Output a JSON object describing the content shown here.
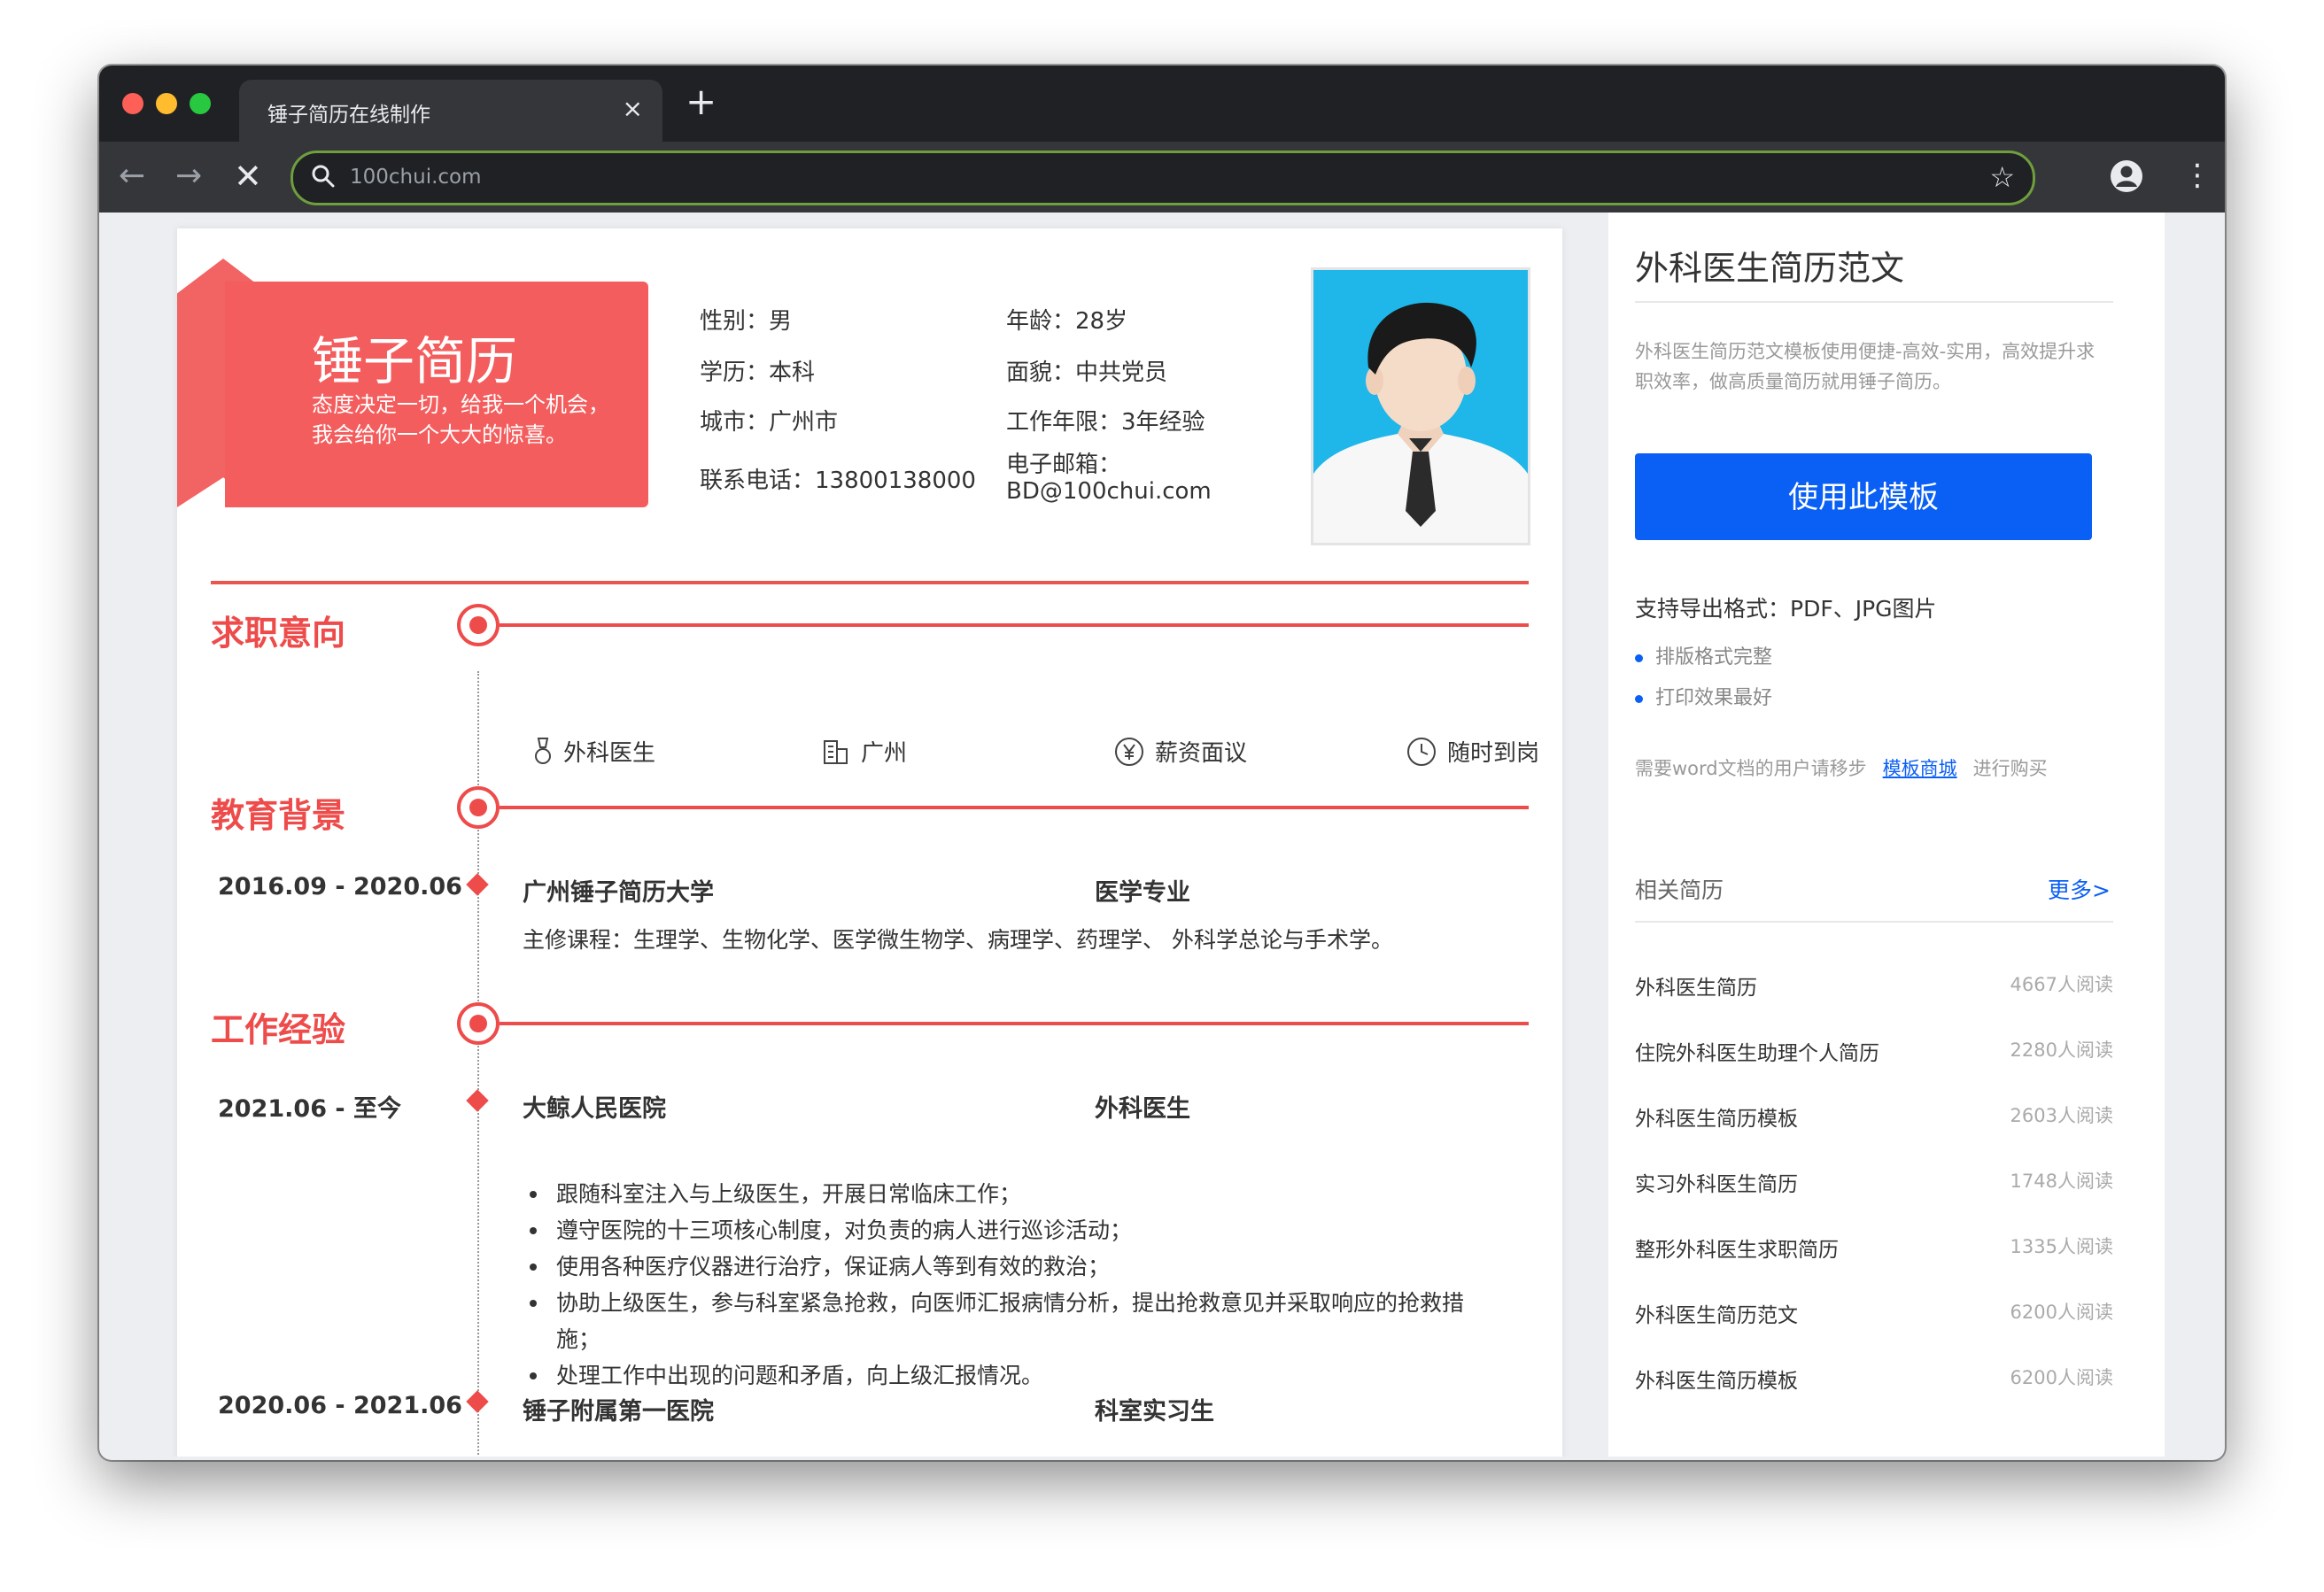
{
  "browser": {
    "tab_title": "锤子简历在线制作",
    "tab_close": "×",
    "new_tab": "+",
    "url": "100chui.com",
    "back": "←",
    "forward": "→",
    "stop": "✕",
    "bookmark_star": "☆",
    "menu": "⋮"
  },
  "resume": {
    "name": "锤子简历",
    "motto": "态度决定一切，给我一个机会，我会给你一个大大的惊喜。",
    "info": {
      "gender": "性别：男",
      "age": "年龄：28岁",
      "education": "学历：本科",
      "politics": "面貌：中共党员",
      "city": "城市：广州市",
      "experience_years": "工作年限：3年经验",
      "phone": "联系电话：13800138000",
      "email_label": "电子邮箱：",
      "email": "BD@100chui.com"
    },
    "sections": {
      "intent": "求职意向",
      "education": "教育背景",
      "work": "工作经验"
    },
    "intent_items": [
      {
        "icon": "medal-icon",
        "label": "外科医生"
      },
      {
        "icon": "building-icon",
        "label": "广州"
      },
      {
        "icon": "yen-icon",
        "label": "薪资面议"
      },
      {
        "icon": "clock-icon",
        "label": "随时到岗"
      }
    ],
    "education": {
      "date": "2016.09 - 2020.06",
      "school": "广州锤子简历大学",
      "major": "医学专业",
      "courses": "主修课程：生理学、生物化学、医学微生物学、病理学、药理学、 外科学总论与手术学。"
    },
    "work": [
      {
        "date": "2021.06 - 至今",
        "org": "大鲸人民医院",
        "role": "外科医生",
        "bullets": [
          "跟随科室注入与上级医生，开展日常临床工作；",
          "遵守医院的十三项核心制度，对负责的病人进行巡诊活动；",
          "使用各种医疗仪器进行治疗，保证病人等到有效的救治；",
          "协助上级医生，参与科室紧急抢救，向医师汇报病情分析，提出抢救意见并采取响应的抢救措施；",
          "处理工作中出现的问题和矛盾，向上级汇报情况。"
        ]
      },
      {
        "date": "2020.06 - 2021.06",
        "org": "锤子附属第一医院",
        "role": "科室实习生"
      }
    ]
  },
  "sidebar": {
    "title": "外科医生简历范文",
    "description": "外科医生简历范文模板使用便捷-高效-实用，高效提升求职效率，做高质量简历就用锤子简历。",
    "use_button": "使用此模板",
    "export_formats": "支持导出格式：PDF、JPG图片",
    "features": [
      "排版格式完整",
      "打印效果最好"
    ],
    "word_prefix": "需要word文档的用户请移步",
    "word_link": "模板商城",
    "word_suffix": "进行购买",
    "related_title": "相关简历",
    "more": "更多>",
    "related": [
      {
        "name": "外科医生简历",
        "reads": "4667人阅读"
      },
      {
        "name": "住院外科医生助理个人简历",
        "reads": "2280人阅读"
      },
      {
        "name": "外科医生简历模板",
        "reads": "2603人阅读"
      },
      {
        "name": "实习外科医生简历",
        "reads": "1748人阅读"
      },
      {
        "name": "整形外科医生求职简历",
        "reads": "1335人阅读"
      },
      {
        "name": "外科医生简历范文",
        "reads": "6200人阅读"
      },
      {
        "name": "外科医生简历模板",
        "reads": "6200人阅读"
      }
    ]
  },
  "colors": {
    "accent_red": "#ee4b4b",
    "button_blue": "#0a5ff5"
  }
}
